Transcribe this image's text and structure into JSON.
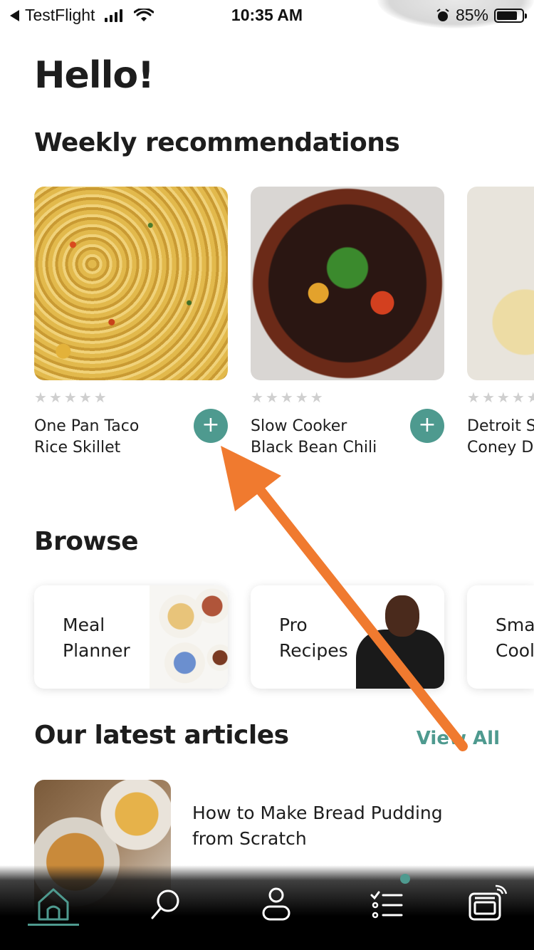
{
  "status_bar": {
    "back_app": "TestFlight",
    "time": "10:35 AM",
    "battery_percent": "85%"
  },
  "greeting": "Hello!",
  "weekly": {
    "title": "Weekly recommendations",
    "cards": [
      {
        "title": "One Pan Taco Rice Skillet",
        "rating": 0,
        "add_label": "+"
      },
      {
        "title": "Slow Cooker Black Bean Chili",
        "rating": 0,
        "add_label": "+"
      },
      {
        "title": "Detroit S Coney Do",
        "rating": 0
      }
    ]
  },
  "browse": {
    "title": "Browse",
    "cards": [
      {
        "label": "Meal Planner"
      },
      {
        "label": "Pro Recipes"
      },
      {
        "label": "Sma Cool"
      }
    ]
  },
  "articles": {
    "title": "Our latest articles",
    "view_all": "View All",
    "items": [
      {
        "title": "How to Make Bread Pudding from Scratch"
      }
    ]
  },
  "tab_bar": {
    "tabs": [
      {
        "icon": "home-icon",
        "active": true
      },
      {
        "icon": "search-icon",
        "active": false
      },
      {
        "icon": "profile-icon",
        "active": false
      },
      {
        "icon": "list-icon",
        "active": false,
        "badge": true
      },
      {
        "icon": "appliance-icon",
        "active": false
      }
    ]
  },
  "colors": {
    "accent": "#4e9a8f",
    "annotation_arrow": "#f07a2f",
    "star_empty": "#cfcfcf"
  }
}
